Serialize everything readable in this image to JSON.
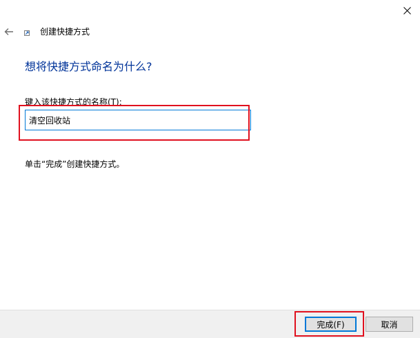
{
  "window": {
    "title": "创建快捷方式",
    "close_icon": "close-icon",
    "back_icon": "back-arrow-icon",
    "shortcut_icon": "shortcut-icon"
  },
  "main": {
    "heading": "想将快捷方式命名为什么?",
    "field_label": "键入该快捷方式的名称(T):",
    "input_value": "清空回收站",
    "hint": "单击“完成”创建快捷方式。"
  },
  "footer": {
    "finish_label": "完成(F)",
    "cancel_label": "取消"
  },
  "colors": {
    "heading": "#003399",
    "highlight": "#e0101e",
    "accent": "#0078d7",
    "footer_bg": "#f0f0f0"
  }
}
